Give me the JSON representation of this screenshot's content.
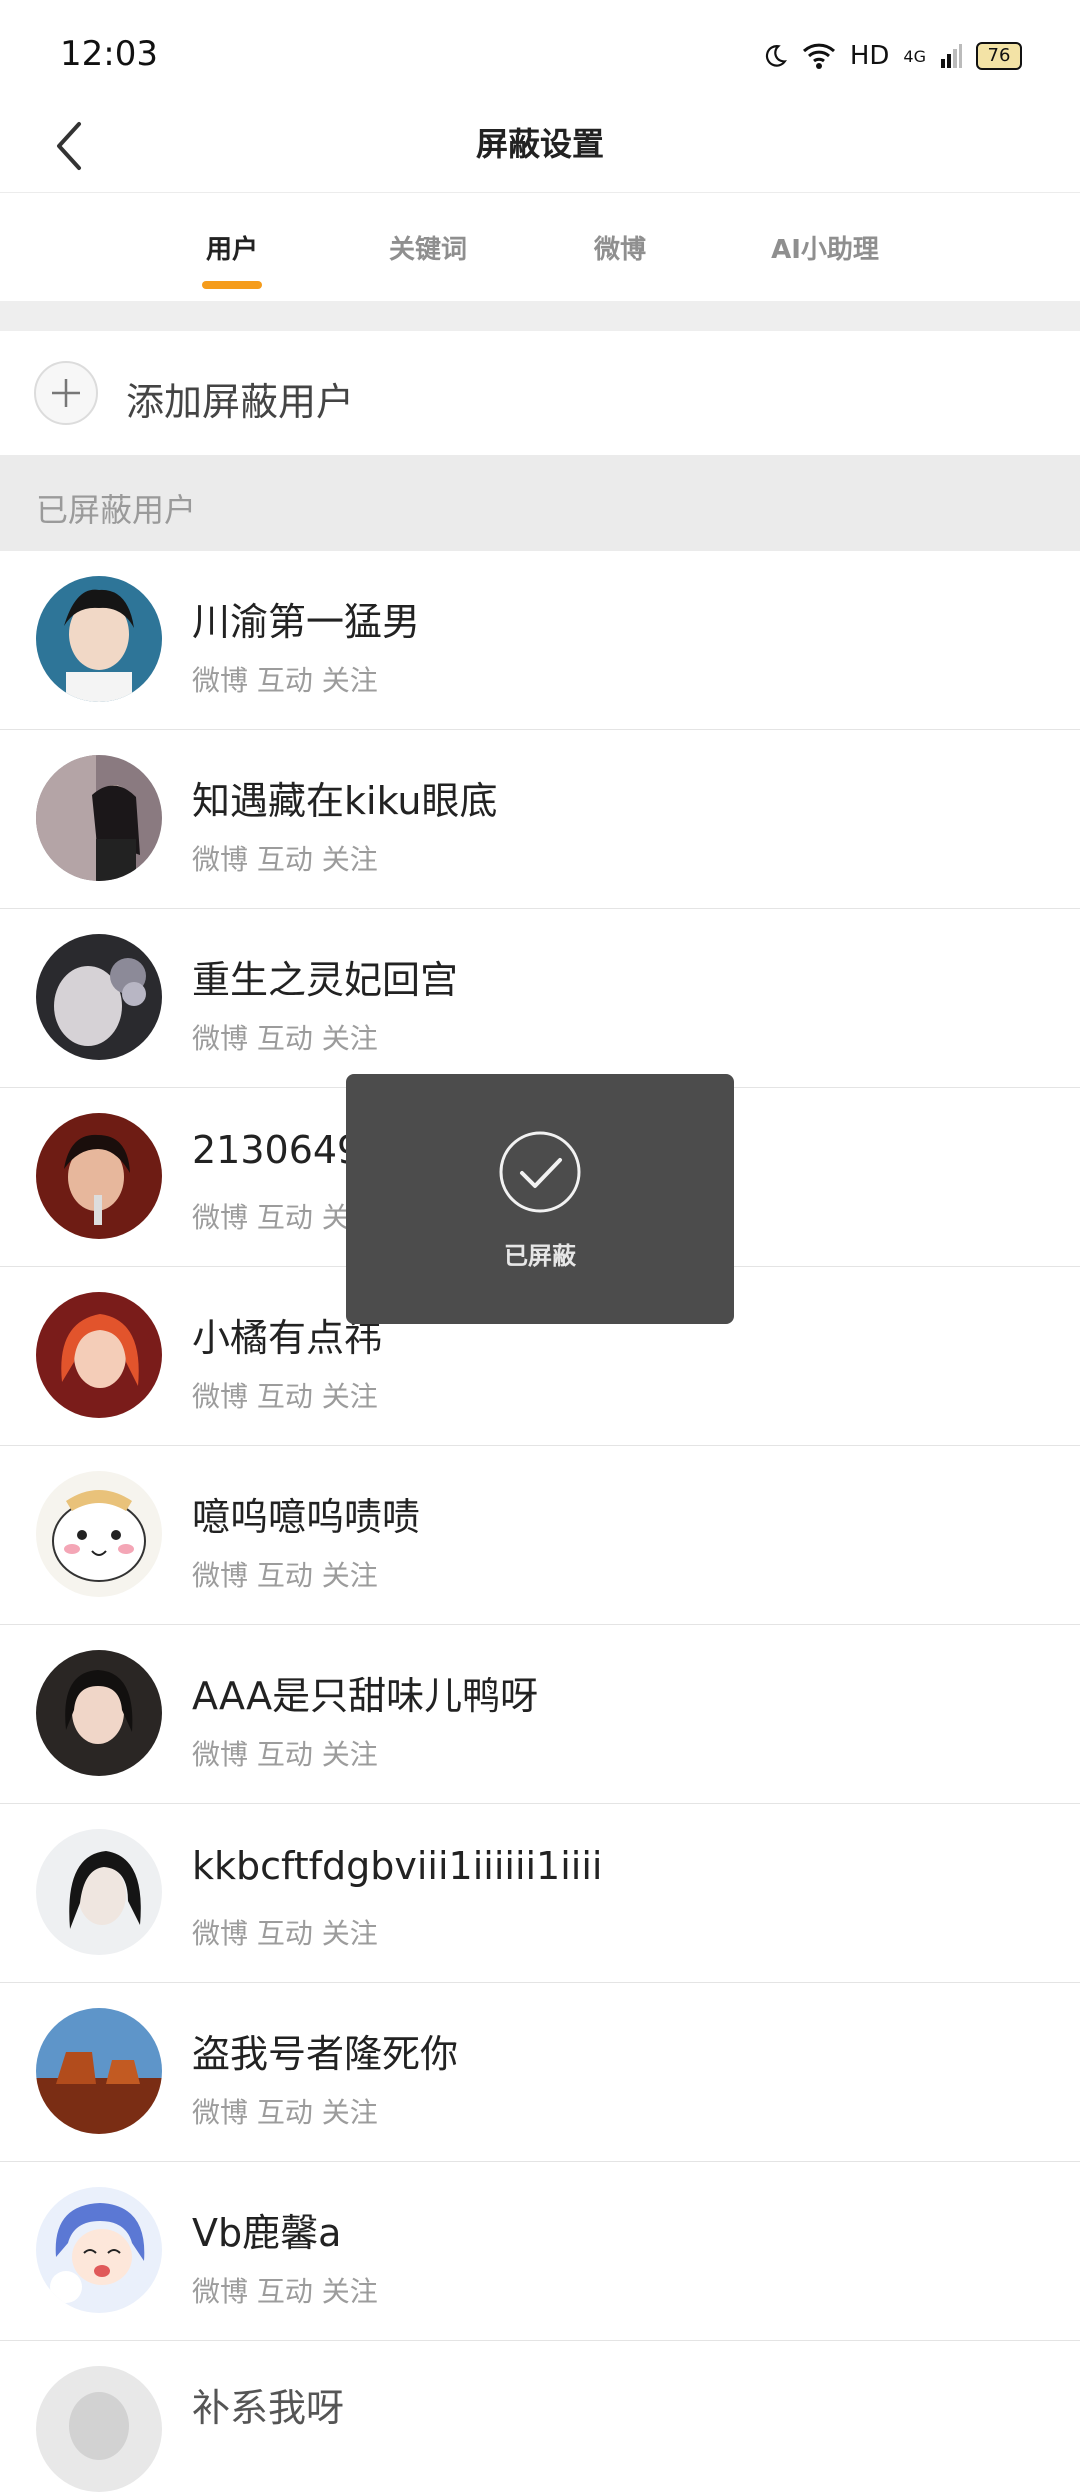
{
  "status": {
    "time": "12:03",
    "network": "HD",
    "signal": "4G",
    "battery": "76"
  },
  "header": {
    "title": "屏蔽设置"
  },
  "tabs": [
    {
      "label": "用户",
      "active": true
    },
    {
      "label": "关键词",
      "active": false
    },
    {
      "label": "微博",
      "active": false
    },
    {
      "label": "AI小助理",
      "active": false
    }
  ],
  "add_user": {
    "label": "添加屏蔽用户"
  },
  "section": {
    "title": "已屏蔽用户"
  },
  "users": [
    {
      "name": "川渝第一猛男",
      "meta": "微博 互动 关注",
      "avatar_color": "#2e6f8f"
    },
    {
      "name": "知遇藏在kiku眼底",
      "meta": "微博 互动 关注",
      "avatar_color": "#6c5a62"
    },
    {
      "name": "重生之灵妃回宫",
      "meta": "微博 互动 关注",
      "avatar_color": "#7c7f8c"
    },
    {
      "name": "2130649767_256",
      "meta": "微博 互动 关注",
      "avatar_color": "#8a2b1e"
    },
    {
      "name": "小橘有点祎",
      "meta": "微博 互动 关注",
      "avatar_color": "#c3402b"
    },
    {
      "name": "噫呜噫呜啧啧",
      "meta": "微博 互动 关注",
      "avatar_color": "#f3efe5"
    },
    {
      "name": "AAA是只甜味儿鸭呀",
      "meta": "微博 互动 关注",
      "avatar_color": "#3a3533"
    },
    {
      "name": "kkbcftfdgbviii1iiiiii1iiii",
      "meta": "微博 互动 关注",
      "avatar_color": "#d8dde2"
    },
    {
      "name": "盗我号者隆死你",
      "meta": "微博 互动 关注",
      "avatar_color": "#c8662c"
    },
    {
      "name": "Vb鹿馨a",
      "meta": "微博 互动 关注",
      "avatar_color": "#6f86d4"
    }
  ],
  "partial_next_user": {
    "name": "补系我呀"
  },
  "toast": {
    "text": "已屏蔽"
  }
}
